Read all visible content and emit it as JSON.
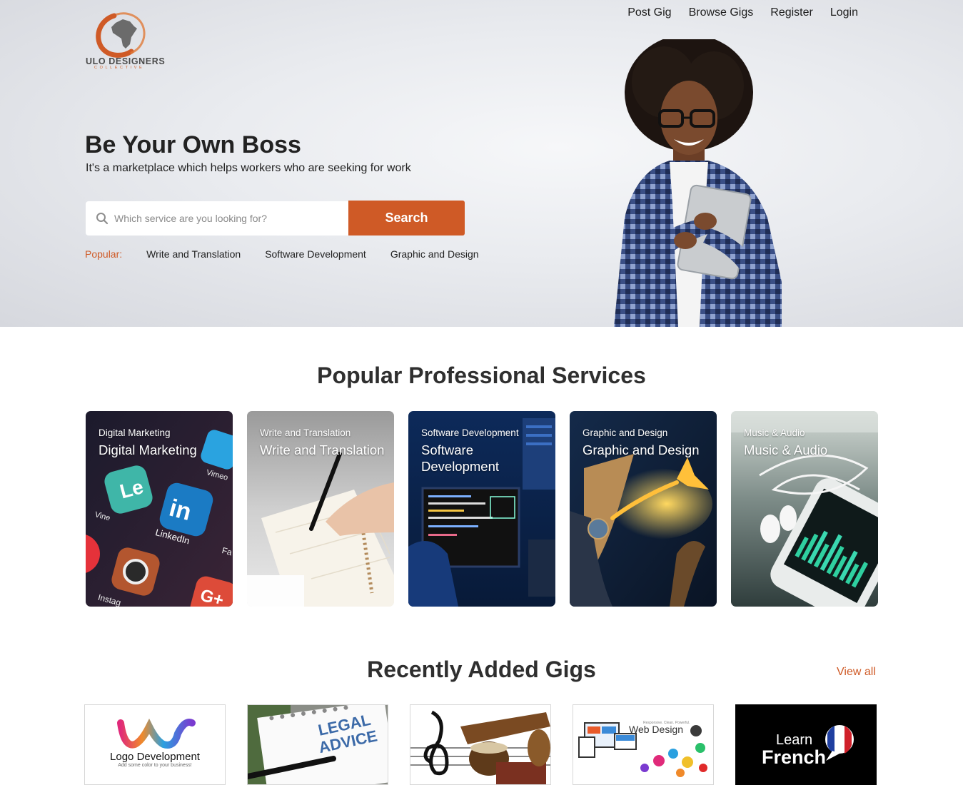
{
  "brand": {
    "name": "ULO DESIGNERS",
    "sub": "COLLECTIVE",
    "accent": "#cf5a26"
  },
  "nav": {
    "items": [
      "Post Gig",
      "Browse Gigs",
      "Register",
      "Login"
    ]
  },
  "hero": {
    "title": "Be Your Own Boss",
    "subtitle": "It's a marketplace which helps workers who are seeking for work",
    "search_placeholder": "Which service are you looking for?",
    "search_value": "",
    "search_button": "Search",
    "popular_label": "Popular:",
    "popular_links": [
      "Write and Translation",
      "Software Development",
      "Graphic and Design"
    ]
  },
  "services": {
    "title": "Popular Professional Services",
    "cards": [
      {
        "small": "Digital Marketing",
        "big": "Digital Marketing"
      },
      {
        "small": "Write and Translation",
        "big": "Write and Translation"
      },
      {
        "small": "Software Development",
        "big": "Software Development"
      },
      {
        "small": "Graphic and Design",
        "big": "Graphic and Design"
      },
      {
        "small": "Music & Audio",
        "big": "Music & Audio"
      }
    ]
  },
  "gigs": {
    "title": "Recently Added Gigs",
    "view_all": "View all",
    "items": [
      {
        "caption": "Logo Development",
        "tag": "Add some color to your business!"
      },
      {
        "caption": "LEGAL ADVICE"
      },
      {
        "caption": ""
      },
      {
        "caption": "Web Design",
        "tag": "Responsive. Clean. Powerful."
      },
      {
        "caption_top": "Learn",
        "caption": "French"
      }
    ]
  },
  "icons": [
    "logo-icon",
    "search-icon",
    "social-icons",
    "pen-icon",
    "monitor-icon",
    "bird-icon",
    "earphones-icon",
    "music-clef-icon",
    "french-flag-icon"
  ]
}
